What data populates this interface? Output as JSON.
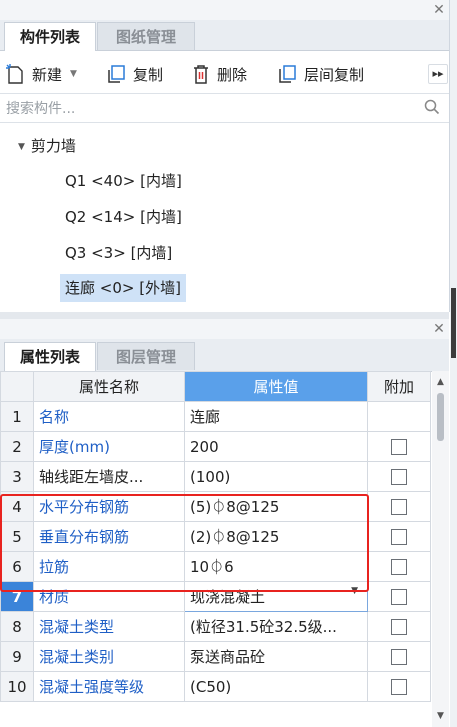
{
  "top_panel": {
    "tabs": [
      {
        "label": "构件列表",
        "active": true
      },
      {
        "label": "图纸管理",
        "active": false
      }
    ],
    "toolbar": {
      "new_label": "新建",
      "copy_label": "复制",
      "delete_label": "删除",
      "floor_copy_label": "层间复制",
      "more_icon": "double-chevron-right-icon"
    },
    "search": {
      "placeholder": "搜索构件..."
    },
    "tree": {
      "group_label": "剪力墙",
      "items": [
        {
          "label": "Q1 <40> [内墙]",
          "selected": false
        },
        {
          "label": "Q2 <14> [内墙]",
          "selected": false
        },
        {
          "label": "Q3 <3> [内墙]",
          "selected": false
        },
        {
          "label": "连廊 <0> [外墙]",
          "selected": true
        }
      ]
    }
  },
  "bottom_panel": {
    "tabs": [
      {
        "label": "属性列表",
        "active": true
      },
      {
        "label": "图层管理",
        "active": false
      }
    ],
    "table": {
      "headers": {
        "name": "属性名称",
        "value": "属性值",
        "extra": "附加"
      },
      "rows": [
        {
          "idx": "1",
          "name": "名称",
          "value": "连廊",
          "link": true,
          "has_check": false
        },
        {
          "idx": "2",
          "name": "厚度(mm)",
          "value": "200",
          "link": true,
          "has_check": true
        },
        {
          "idx": "3",
          "name": "轴线距左墙皮...",
          "value": "(100)",
          "link": false,
          "has_check": true
        },
        {
          "idx": "4",
          "name": "水平分布钢筋",
          "value": "(5)⏀8@125",
          "link": true,
          "has_check": true
        },
        {
          "idx": "5",
          "name": "垂直分布钢筋",
          "value": "(2)⏀8@125",
          "link": true,
          "has_check": true
        },
        {
          "idx": "6",
          "name": "拉筋",
          "value": "10⏀6",
          "link": true,
          "has_check": true
        },
        {
          "idx": "7",
          "name": "材质",
          "value": "现浇混凝土",
          "link": true,
          "has_check": true,
          "selected": true,
          "dropdown": true
        },
        {
          "idx": "8",
          "name": "混凝土类型",
          "value": "(粒径31.5砼32.5级...",
          "link": true,
          "has_check": true
        },
        {
          "idx": "9",
          "name": "混凝土类别",
          "value": "泵送商品砼",
          "link": true,
          "has_check": true
        },
        {
          "idx": "10",
          "name": "混凝土强度等级",
          "value": "(C50)",
          "link": true,
          "has_check": true
        }
      ]
    }
  },
  "colors": {
    "accent": "#3b84d9",
    "link_text": "#1f5fc6",
    "selected_tree_bg": "#cfe2f7",
    "highlight_box": "#e8231f"
  }
}
